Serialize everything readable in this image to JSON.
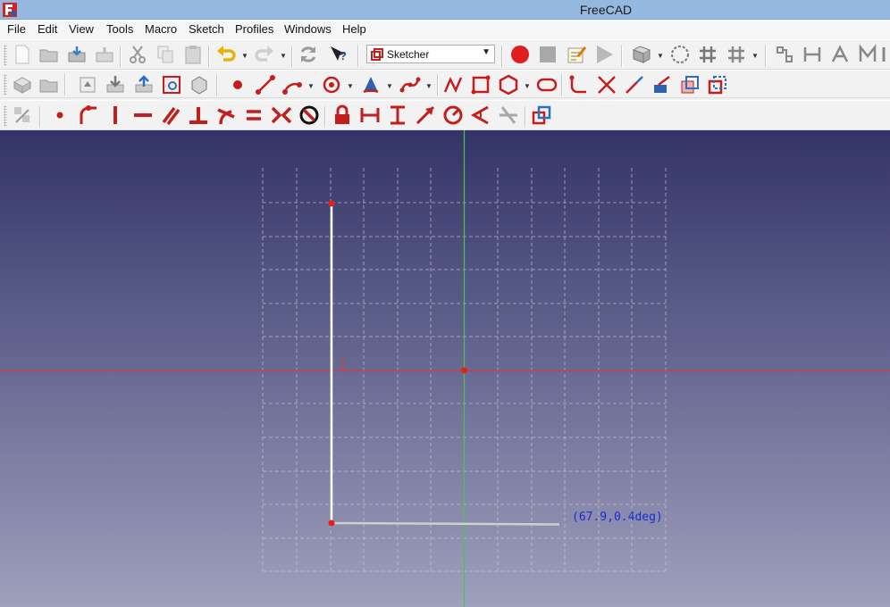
{
  "window": {
    "title": "FreeCAD"
  },
  "menu": [
    "File",
    "Edit",
    "View",
    "Tools",
    "Macro",
    "Sketch",
    "Profiles",
    "Windows",
    "Help"
  ],
  "workbench_selector": {
    "value": "Sketcher"
  },
  "toolbars": {
    "row1_icons": [
      "new-document-icon",
      "open-document-icon",
      "save-document-icon",
      "save-as-icon",
      "cut-icon",
      "copy-icon",
      "paste-icon",
      "undo-icon",
      "redo-icon",
      "refresh-icon",
      "whats-this-icon",
      "macro-record-icon",
      "macro-stop-icon",
      "macro-edit-icon",
      "macro-play-icon",
      "view-fit-icon",
      "view-sketch-icon",
      "view-section-icon",
      "geometry-node-icon",
      "merge-sketches-icon",
      "mirror-sketch-icon",
      "constraint-node-icon",
      "select-constraints-icon",
      "close-sketch-icon",
      "reorient-icon"
    ],
    "row2_icons": [
      "new-sketch-icon",
      "open-sketch-icon",
      "leave-sketch-icon",
      "view-sketch-icon",
      "map-sketch-icon",
      "reorient-sketch-icon",
      "validate-sketch-icon",
      "point-icon",
      "line-icon",
      "arc-icon",
      "circle-icon",
      "conic-icon",
      "bspline-icon",
      "polyline-icon",
      "rectangle-icon",
      "polygon-icon",
      "slot-icon",
      "fillet-icon",
      "trim-icon",
      "extend-icon",
      "external-geometry-icon",
      "carbon-copy-icon",
      "construction-mode-icon"
    ],
    "row3_icons": [
      "coincident-constraint-icon",
      "point-on-object-icon",
      "vertical-constraint-icon",
      "horizontal-constraint-icon",
      "parallel-constraint-icon",
      "perpendicular-constraint-icon",
      "tangent-constraint-icon",
      "equal-constraint-icon",
      "symmetric-constraint-icon",
      "block-constraint-icon",
      "lock-constraint-icon",
      "horizontal-distance-icon",
      "vertical-distance-icon",
      "distance-constraint-icon",
      "radius-constraint-icon",
      "angle-constraint-icon",
      "snell-law-icon",
      "toggle-driving-icon"
    ]
  },
  "viewport": {
    "cursor_readout": "(67.9,0.4deg)",
    "colors": {
      "x_axis": "#d63a3a",
      "y_axis": "#4fc14f",
      "grid": "#c8c8d4",
      "sketch_line": "#ffffff",
      "preview_line": "#cfcfcf",
      "point": "#e8200f",
      "readout": "#1a2bd8"
    }
  }
}
